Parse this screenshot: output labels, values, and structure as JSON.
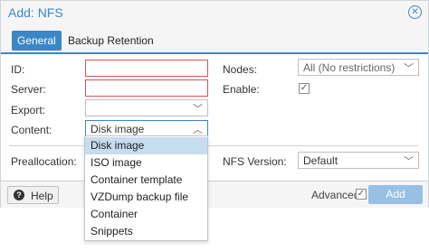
{
  "dialog": {
    "title": "Add: NFS",
    "close_glyph": "⊗"
  },
  "tabs": [
    {
      "label": "General",
      "active": true
    },
    {
      "label": "Backup Retention",
      "active": false
    }
  ],
  "form": {
    "id": {
      "label": "ID:",
      "value": ""
    },
    "server": {
      "label": "Server:",
      "value": ""
    },
    "export": {
      "label": "Export:",
      "value": ""
    },
    "content": {
      "label": "Content:",
      "value": "Disk image"
    },
    "nodes": {
      "label": "Nodes:",
      "value": "All (No restrictions)"
    },
    "enable": {
      "label": "Enable:",
      "checked": true
    },
    "preallocation": {
      "label": "Preallocation:",
      "value": ""
    },
    "nfs_version": {
      "label": "NFS Version:",
      "value": "Default"
    }
  },
  "content_options": [
    "Disk image",
    "ISO image",
    "Container template",
    "VZDump backup file",
    "Container",
    "Snippets"
  ],
  "content_selected_index": 0,
  "footer": {
    "help_label": "Help",
    "advanced_label": "Advanced",
    "advanced_checked": true,
    "add_label": "Add"
  },
  "colors": {
    "accent": "#3a87c8",
    "invalid_border": "#d9534f",
    "add_disabled": "#98c0e5",
    "selected_item": "#c6dcef"
  }
}
